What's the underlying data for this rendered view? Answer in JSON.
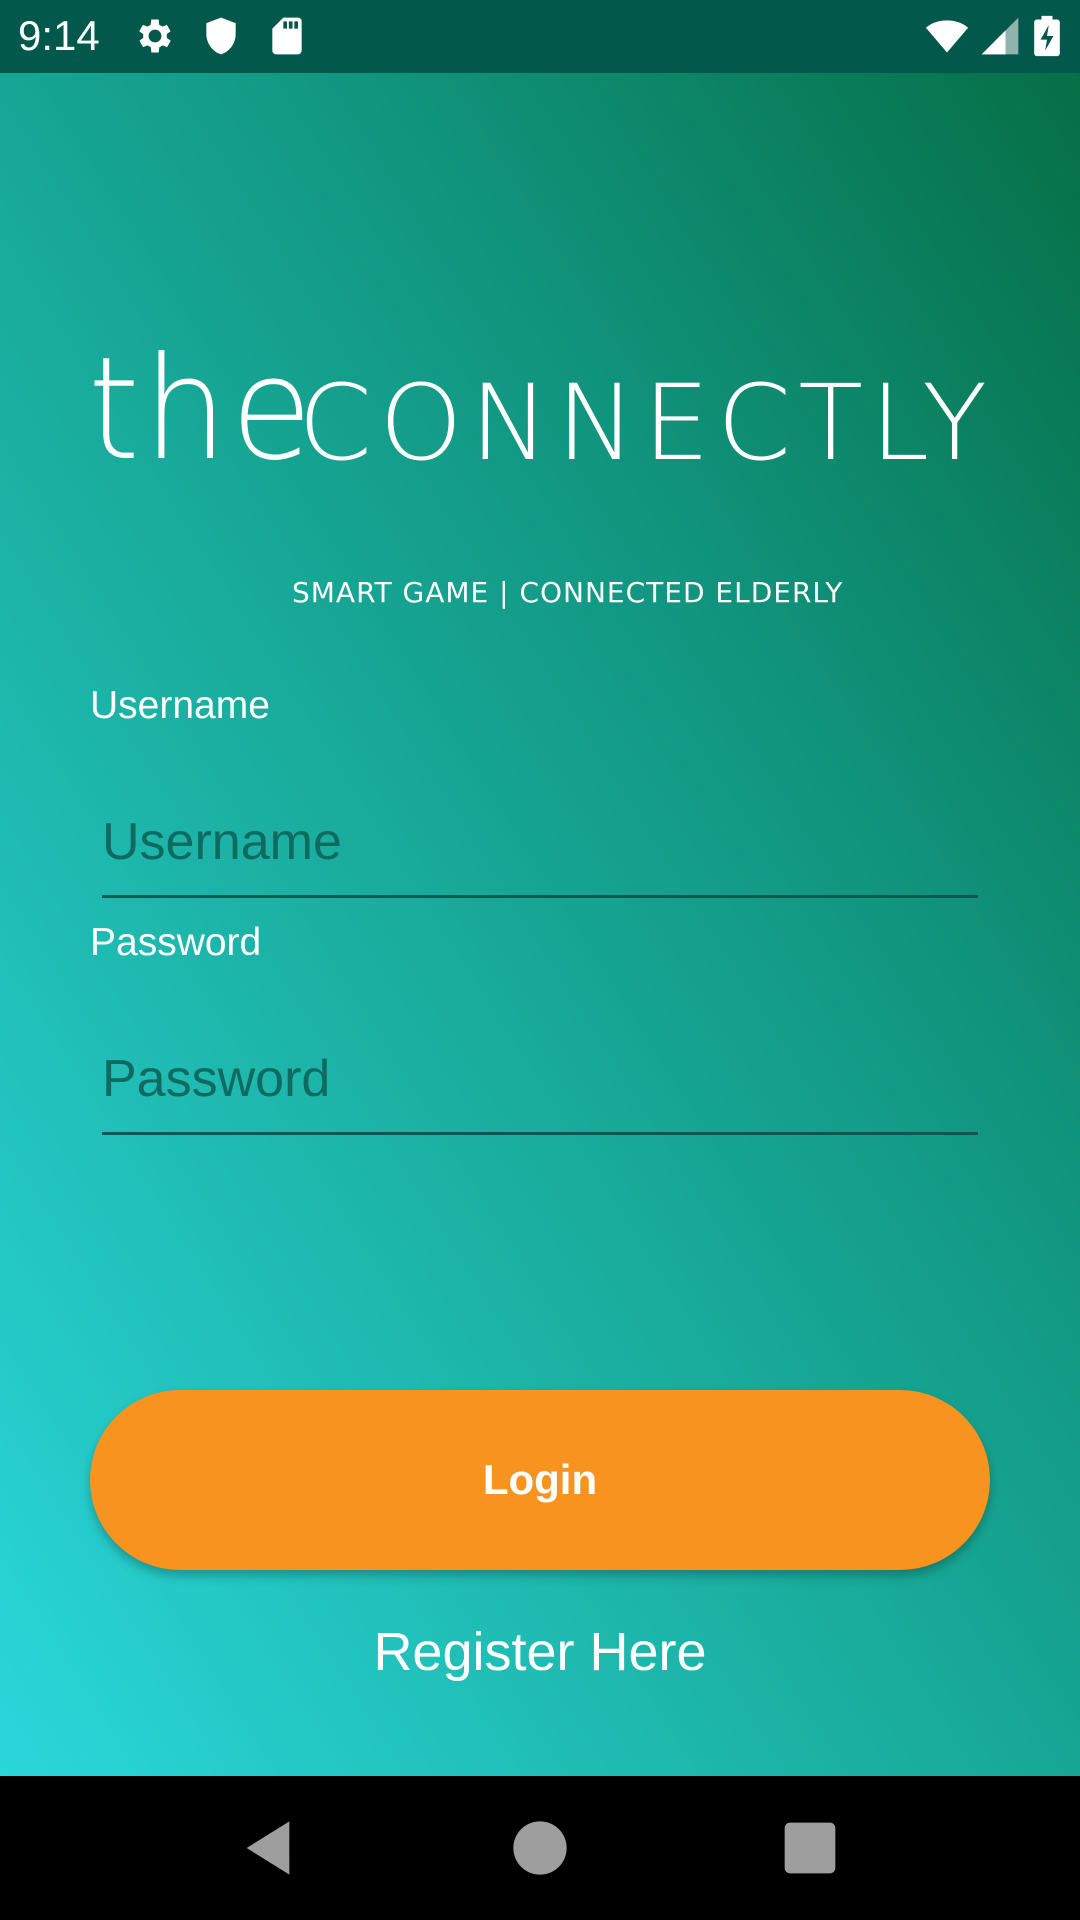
{
  "status_bar": {
    "time": "9:14",
    "left_icons": [
      "gear-icon",
      "shield-icon",
      "sd-card-icon"
    ],
    "right_icons": [
      "wifi-icon",
      "signal-icon",
      "battery-charging-icon"
    ]
  },
  "logo": {
    "prefix": "the",
    "name": "CONNECTLY",
    "tagline": "SMART GAME | CONNECTED ELDERLY"
  },
  "form": {
    "username_label": "Username",
    "username_placeholder": "Username",
    "username_value": "",
    "password_label": "Password",
    "password_placeholder": "Password",
    "password_value": ""
  },
  "actions": {
    "login_label": "Login",
    "register_label": "Register Here"
  },
  "nav_bar": {
    "buttons": [
      "back-icon",
      "home-icon",
      "recents-icon"
    ]
  },
  "colors": {
    "status_bar": "#02594b",
    "gradient_light": "#2ad7db",
    "gradient_dark": "#066f46",
    "login_button": "#f7931e",
    "input_text": "#0f6b61"
  }
}
